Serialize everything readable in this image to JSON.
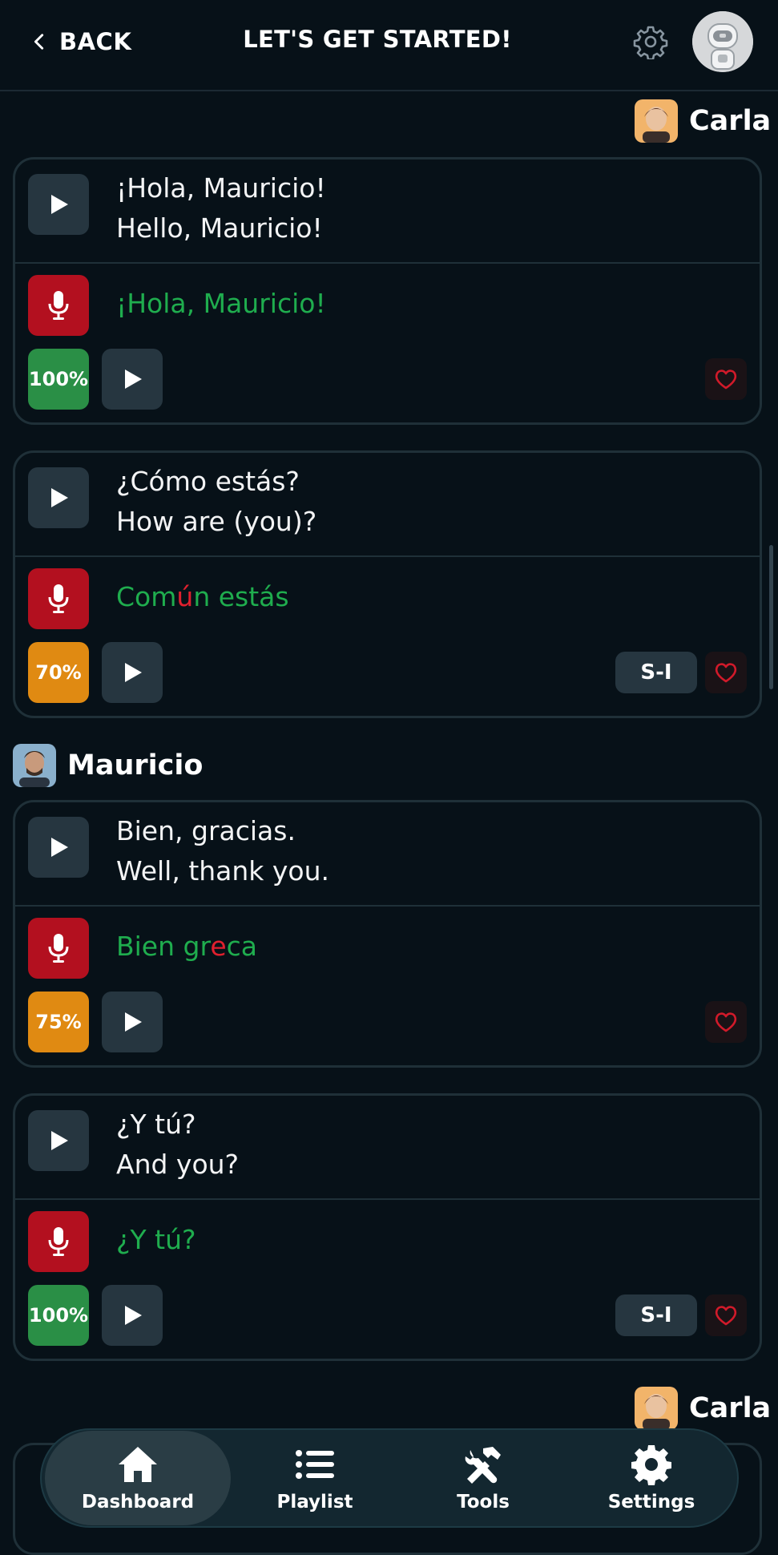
{
  "header": {
    "back_label": "BACK",
    "title": "LET'S GET STARTED!"
  },
  "conversation": [
    {
      "speaker": "Carla",
      "cards": [
        {
          "spanish": "¡Hola, Mauricio!",
          "english": "Hello, Mauricio!",
          "attempt_parts": [
            {
              "text": "¡Hola, Mauricio!",
              "ok": true
            }
          ],
          "score": "100%",
          "score_color": "#2a8f46",
          "si": null
        },
        {
          "spanish": "¿Cómo estás?",
          "english": "How are (you)?",
          "attempt_parts": [
            {
              "text": "Com",
              "ok": true
            },
            {
              "text": "ú",
              "ok": false
            },
            {
              "text": "n estás",
              "ok": true
            }
          ],
          "score": "70%",
          "score_color": "#e08a12",
          "si": "S-I"
        }
      ]
    },
    {
      "speaker": "Mauricio",
      "cards": [
        {
          "spanish": "Bien, gracias.",
          "english": "Well, thank you.",
          "attempt_parts": [
            {
              "text": "Bien gr",
              "ok": true
            },
            {
              "text": "e",
              "ok": false
            },
            {
              "text": "ca",
              "ok": true
            }
          ],
          "score": "75%",
          "score_color": "#e08a12",
          "si": null
        },
        {
          "spanish": "¿Y tú?",
          "english": "And you?",
          "attempt_parts": [
            {
              "text": "¿Y tú?",
              "ok": true
            }
          ],
          "score": "100%",
          "score_color": "#2a8f46",
          "si": "S-I"
        }
      ]
    },
    {
      "speaker": "Carla",
      "cards": []
    }
  ],
  "nav": {
    "dashboard": "Dashboard",
    "playlist": "Playlist",
    "tools": "Tools",
    "settings": "Settings"
  },
  "colors": {
    "background": "#071118",
    "correct": "#1fad4e",
    "wrong": "#e0202e",
    "mic": "#b3101f"
  }
}
